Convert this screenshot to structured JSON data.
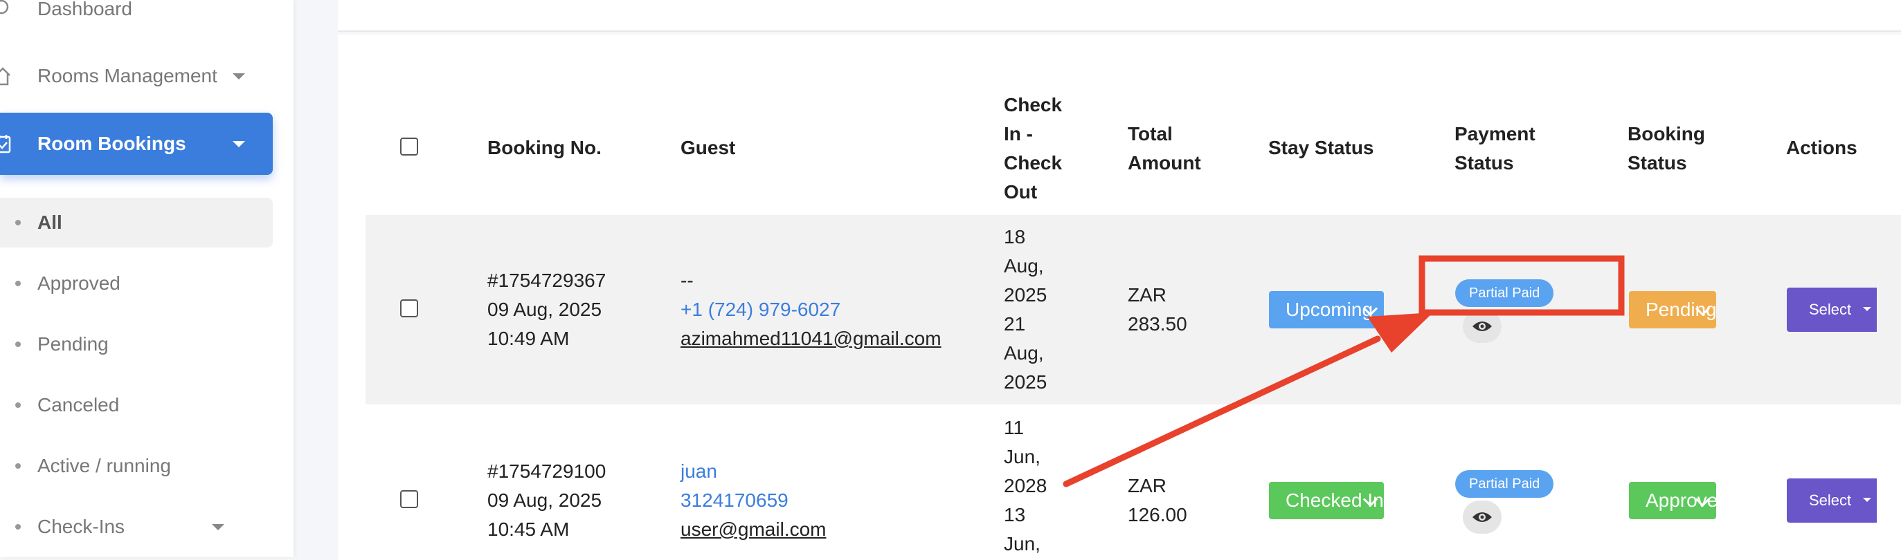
{
  "sidebar": {
    "items": [
      {
        "label": "Dashboard"
      },
      {
        "label": "Rooms Management"
      },
      {
        "label": "Room Bookings"
      }
    ],
    "sub_items": [
      {
        "label": "All"
      },
      {
        "label": "Approved"
      },
      {
        "label": "Pending"
      },
      {
        "label": "Canceled"
      },
      {
        "label": "Active / running"
      },
      {
        "label": "Check-Ins"
      }
    ]
  },
  "table": {
    "headers": {
      "booking_no": "Booking No.",
      "guest": "Guest",
      "checkin_1": "Check",
      "checkin_2": "In -",
      "checkin_3": "Check",
      "checkin_4": "Out",
      "total_1": "Total",
      "total_2": "Amount",
      "stay_status": "Stay Status",
      "payment_1": "Payment",
      "payment_2": "Status",
      "booking_1": "Booking",
      "booking_2": "Status",
      "actions": "Actions"
    },
    "rows": [
      {
        "booking_no": "#1754729367",
        "date": "09 Aug, 2025",
        "time": "10:49 AM",
        "guest_name": "--",
        "guest_phone": "+1 (724) 979-6027",
        "guest_email": "azimahmed11041@gmail.com",
        "checkin_lines": [
          "18",
          "Aug,",
          "2025",
          "21",
          "Aug,",
          "2025"
        ],
        "currency": "ZAR",
        "amount": "283.50",
        "stay_status": "Upcoming",
        "payment_status": "Partial Paid",
        "booking_status": "Pending",
        "action": "Select"
      },
      {
        "booking_no": "#1754729100",
        "date": "09 Aug, 2025",
        "time": "10:45 AM",
        "guest_name": "juan",
        "guest_phone": "3124170659",
        "guest_email": "user@gmail.com",
        "checkin_lines": [
          "11",
          "Jun,",
          "2028",
          "13",
          "Jun,"
        ],
        "currency": "ZAR",
        "amount": "126.00",
        "stay_status": "Checked In",
        "payment_status": "Partial Paid",
        "booking_status": "Approved",
        "action": "Select"
      }
    ]
  },
  "colors": {
    "primary": "#3b7ddd",
    "stay_upcoming": "#5aa3f0",
    "stay_checked_in": "#5bc85b",
    "booking_pending": "#f0ad4e",
    "booking_approved": "#5bc85b",
    "action_button": "#6a55c9",
    "annotation": "#e8412c"
  }
}
